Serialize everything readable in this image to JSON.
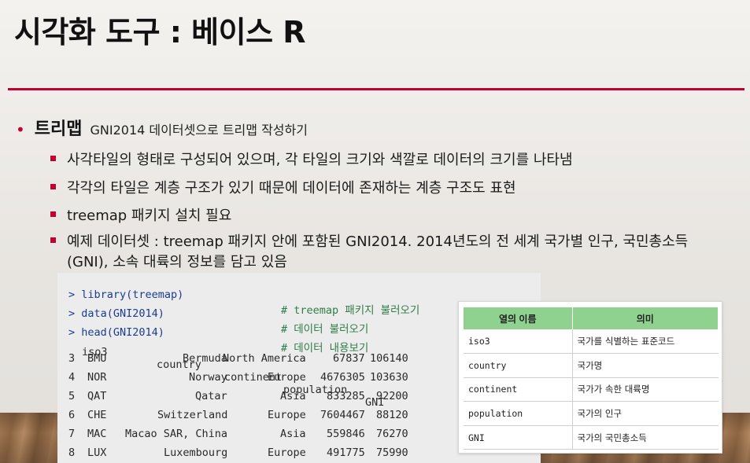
{
  "slide": {
    "title": "시각화 도구 : 베이스 R",
    "bullet": {
      "heading": "트리맵",
      "subtitle": "GNI2014 데이터셋으로 트리맵 작성하기",
      "items": [
        {
          "text": "사각타일의 형태로 구성되어 있으며, 각 타일의 크기와 색깔로 데이터의 크기를 나타냄"
        },
        {
          "text": "각각의 타일은 계층 구조가 있기 때문에 데이터에 존재하는 계층 구조도 표현"
        },
        {
          "text": "treemap 패키지 설치 필요"
        },
        {
          "text": "예제 데이터셋 : treemap 패키지 안에 포함된 GNI2014. 2014년도의 전 세계 국가별 인구, 국민총소득",
          "cont": "(GNI), 소속 대륙의 정보를 담고 있음"
        }
      ]
    }
  },
  "code": {
    "commands": [
      {
        "cmd": "> library(treemap)",
        "comment": "# treemap 패키지 불러오기"
      },
      {
        "cmd": "> data(GNI2014)",
        "comment": "# 데이터 불러오기"
      },
      {
        "cmd": "> head(GNI2014)",
        "comment": "# 데이터 내용보기"
      }
    ],
    "header": [
      "iso3",
      "country",
      "continent",
      "population",
      "GNI"
    ],
    "rows": [
      {
        "idx": "3",
        "iso3": "BMU",
        "country": "Bermuda",
        "continent": "North America",
        "population": "67837",
        "gni": "106140"
      },
      {
        "idx": "4",
        "iso3": "NOR",
        "country": "Norway",
        "continent": "Europe",
        "population": "4676305",
        "gni": "103630"
      },
      {
        "idx": "5",
        "iso3": "QAT",
        "country": "Qatar",
        "continent": "Asia",
        "population": "833285",
        "gni": "92200"
      },
      {
        "idx": "6",
        "iso3": "CHE",
        "country": "Switzerland",
        "continent": "Europe",
        "population": "7604467",
        "gni": "88120"
      },
      {
        "idx": "7",
        "iso3": "MAC",
        "country": "Macao SAR, China",
        "continent": "Asia",
        "population": "559846",
        "gni": "76270"
      },
      {
        "idx": "8",
        "iso3": "LUX",
        "country": "Luxembourg",
        "continent": "Europe",
        "population": "491775",
        "gni": "75990"
      }
    ]
  },
  "meta_table": {
    "headers": [
      "열의 이름",
      "의미"
    ],
    "rows": [
      {
        "name": "iso3",
        "meaning": "국가를 식별하는 표준코드"
      },
      {
        "name": "country",
        "meaning": "국가명"
      },
      {
        "name": "continent",
        "meaning": "국가가 속한 대륙명"
      },
      {
        "name": "population",
        "meaning": "국가의 인구"
      },
      {
        "name": "GNI",
        "meaning": "국가의 국민총소득"
      }
    ]
  },
  "colors": {
    "accent": "#c3002f",
    "table_header": "#8fd18f",
    "code_bg": "#ececec"
  }
}
